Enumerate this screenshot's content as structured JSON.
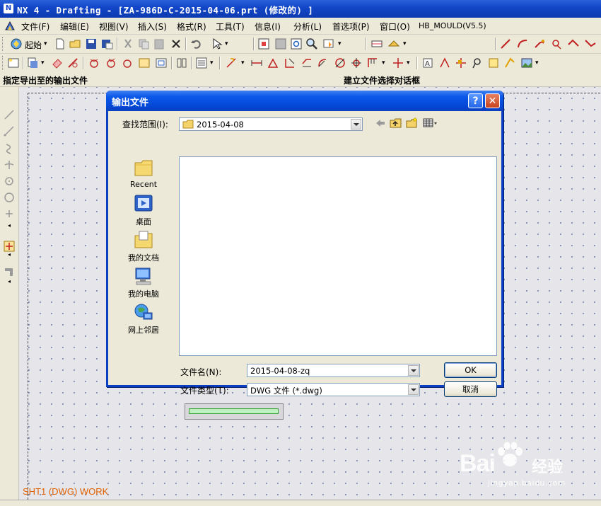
{
  "window": {
    "title": "NX 4 - Drafting - [ZA-986D-C-2015-04-06.prt  (修改的)  ]"
  },
  "menubar": {
    "items": [
      "文件(F)",
      "编辑(E)",
      "视图(V)",
      "插入(S)",
      "格式(R)",
      "工具(T)",
      "信息(I)",
      "分析(L)",
      "首选项(P)",
      "窗口(O)",
      "HB_MOULD(V5.5)"
    ]
  },
  "toolbar": {
    "start_label": "起始"
  },
  "prompt": {
    "left": "指定导出至的输出文件",
    "right": "建立文件选择对话框"
  },
  "canvas": {
    "sheet_label": "SHT1 (DWG) WORK"
  },
  "dialog": {
    "title": "输出文件",
    "help_label": "?",
    "close_label": "✕",
    "look_in_label": "查找范围(I):",
    "look_in_value": "2015-04-08",
    "places": [
      "Recent",
      "桌面",
      "我的文档",
      "我的电脑",
      "网上邻居"
    ],
    "filename_label": "文件名(N):",
    "filename_value": "2015-04-08-zq",
    "filetype_label": "文件类型(T):",
    "filetype_value": "DWG 文件 (*.dwg)",
    "ok_label": "OK",
    "cancel_label": "取消"
  },
  "watermark": {
    "brand": "Bai",
    "brand_suffix": "经验",
    "url": "jingyan.baidu.com"
  },
  "colors": {
    "title_blue": "#1347c8",
    "dialog_blue": "#0b3fc4",
    "sheet_label": "#e06000",
    "canvas": "#e6e6ea"
  }
}
